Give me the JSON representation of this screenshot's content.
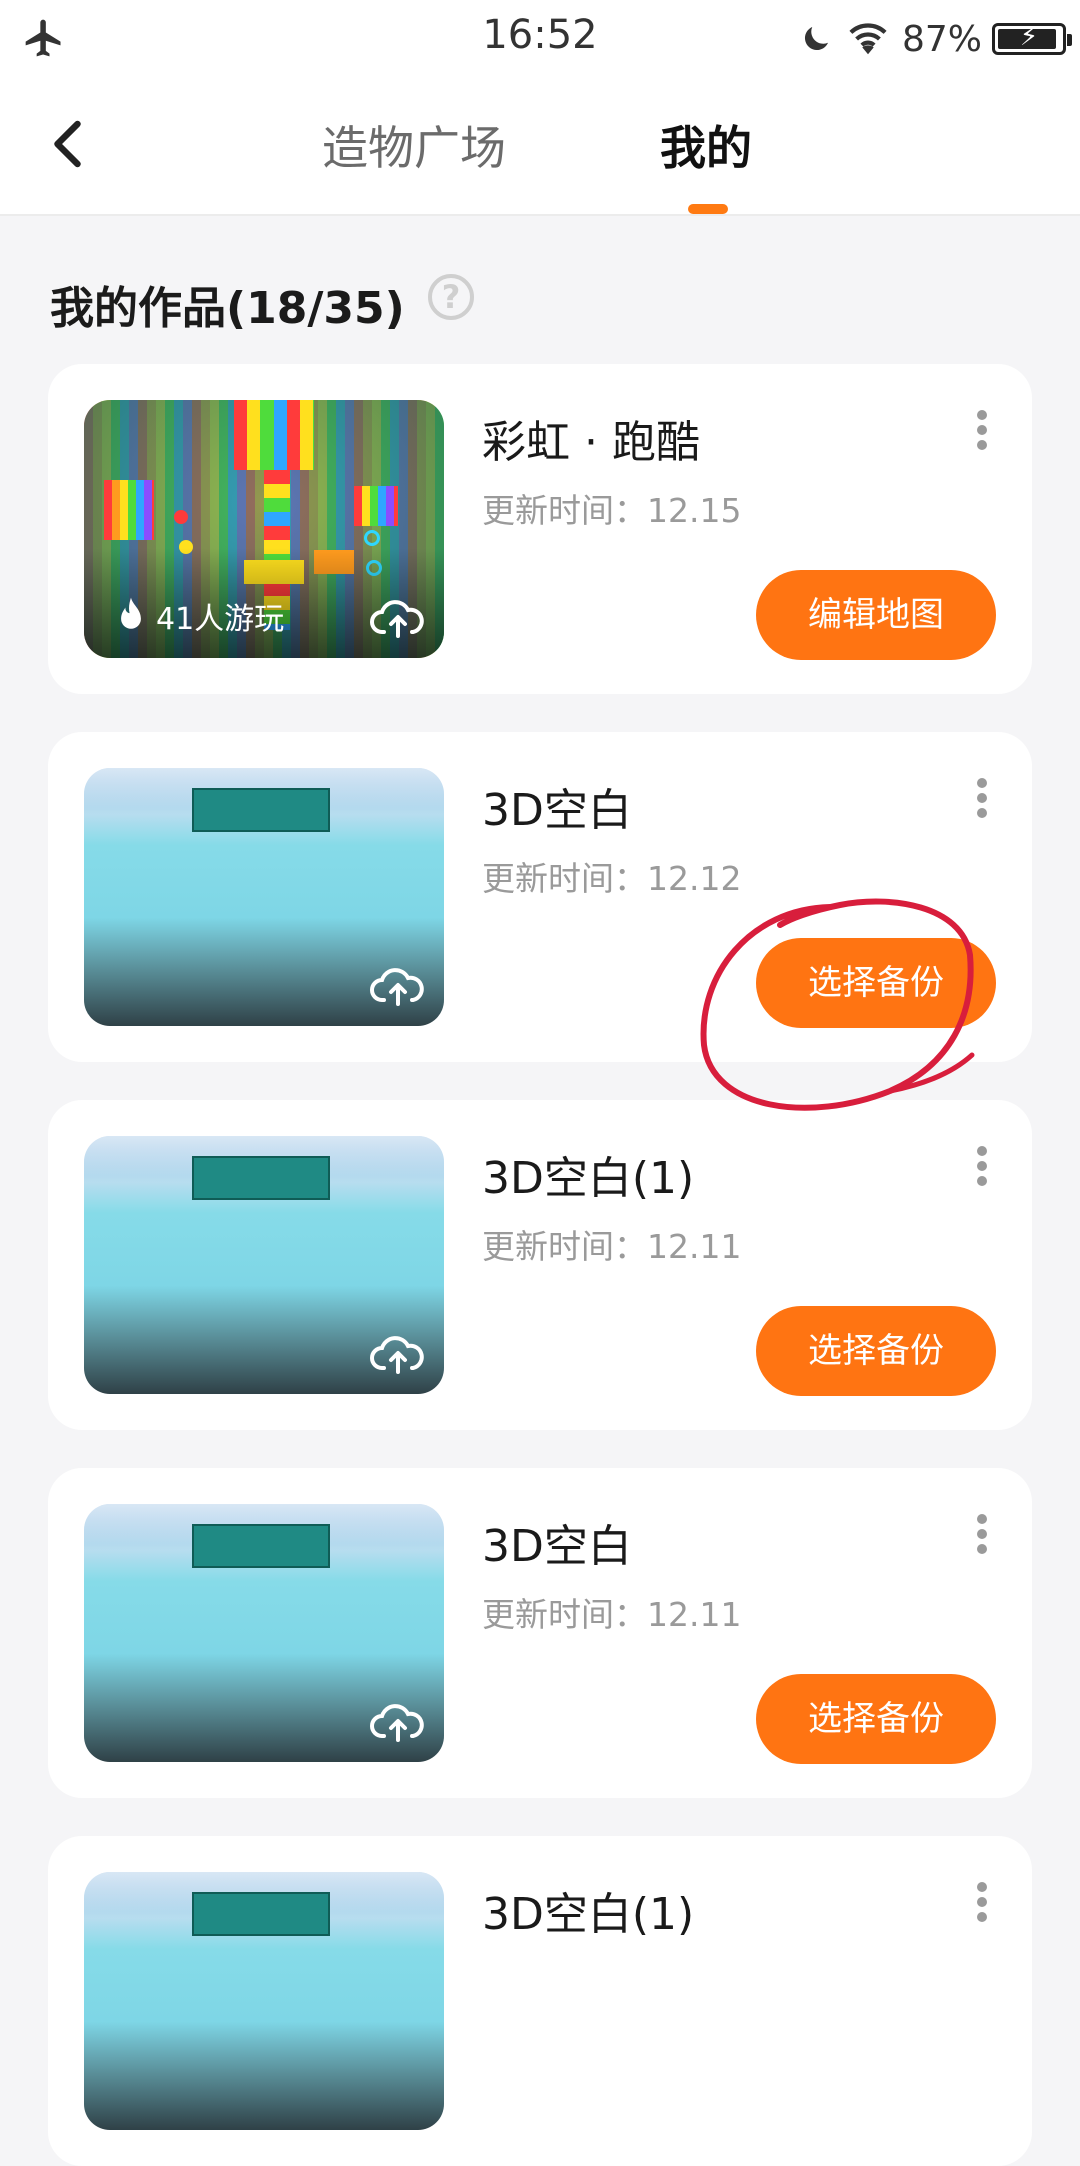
{
  "status_bar": {
    "time": "16:52",
    "battery_percent": "87%",
    "battery_level": 0.87
  },
  "nav": {
    "tabs": [
      "造物广场",
      "我的"
    ],
    "active_tab": "我的"
  },
  "section": {
    "title": "我的作品(18/35)",
    "help_icon": "?"
  },
  "works": [
    {
      "name": "彩虹 · 跑酷",
      "updated": "更新时间：12.15",
      "plays": "41人游玩",
      "button": "编辑地图"
    },
    {
      "name": "3D空白",
      "updated": "更新时间：12.12",
      "button": "选择备份"
    },
    {
      "name": "3D空白(1)",
      "updated": "更新时间：12.11",
      "button": "选择备份"
    },
    {
      "name": "3D空白",
      "updated": "更新时间：12.11",
      "button": "选择备份"
    },
    {
      "name": "3D空白(1)"
    }
  ],
  "colors": {
    "accent": "#ff7412",
    "annotation": "#d81e3c"
  }
}
